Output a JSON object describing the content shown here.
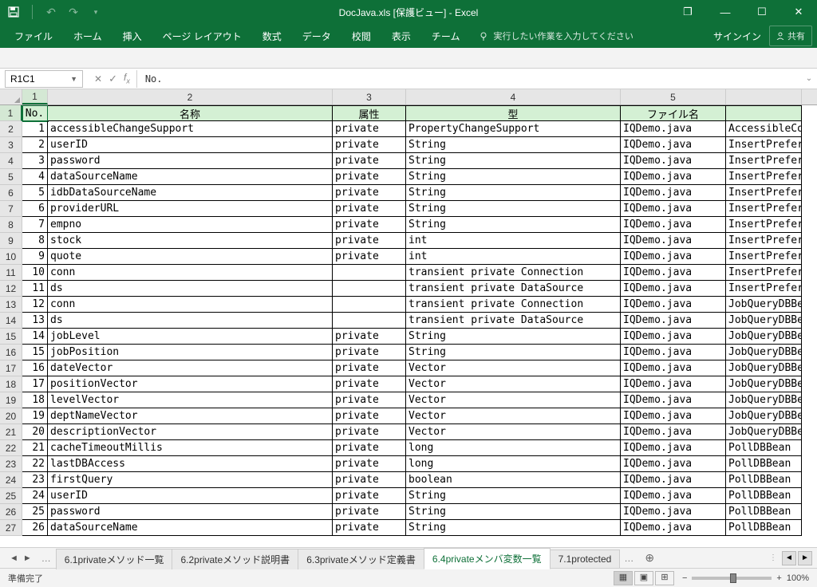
{
  "title": "DocJava.xls  [保護ビュー] - Excel",
  "qat": {
    "undo": "↶",
    "redo": "↷"
  },
  "winbtns": {
    "restore": "❐",
    "min": "—",
    "max": "☐",
    "close": "✕"
  },
  "tabs": [
    "ファイル",
    "ホーム",
    "挿入",
    "ページ レイアウト",
    "数式",
    "データ",
    "校閲",
    "表示",
    "チーム"
  ],
  "tellme": "実行したい作業を入力してください",
  "signin": "サインイン",
  "share": "共有",
  "namebox": "R1C1",
  "fx_value": "No.",
  "col_headers": [
    "1",
    "2",
    "3",
    "4",
    "5"
  ],
  "table": {
    "headers": [
      "No.",
      "名称",
      "属性",
      "型",
      "ファイル名",
      ""
    ],
    "rows": [
      [
        "1",
        "accessibleChangeSupport",
        "private",
        "PropertyChangeSupport",
        "IQDemo.java",
        "AccessibleCo"
      ],
      [
        "2",
        "userID",
        "private",
        "String",
        "IQDemo.java",
        "InsertPrefer"
      ],
      [
        "3",
        "password",
        "private",
        "String",
        "IQDemo.java",
        "InsertPrefer"
      ],
      [
        "4",
        "dataSourceName",
        "private",
        "String",
        "IQDemo.java",
        "InsertPrefer"
      ],
      [
        "5",
        "idbDataSourceName",
        "private",
        "String",
        "IQDemo.java",
        "InsertPrefer"
      ],
      [
        "6",
        "providerURL",
        "private",
        "String",
        "IQDemo.java",
        "InsertPrefer"
      ],
      [
        "7",
        "empno",
        "private",
        "String",
        "IQDemo.java",
        "InsertPrefer"
      ],
      [
        "8",
        "stock",
        "private",
        "int",
        "IQDemo.java",
        "InsertPrefer"
      ],
      [
        "9",
        "quote",
        "private",
        "int",
        "IQDemo.java",
        "InsertPrefer"
      ],
      [
        "10",
        "conn",
        "",
        "transient private Connection",
        "IQDemo.java",
        "InsertPrefer"
      ],
      [
        "11",
        "ds",
        "",
        "transient private DataSource",
        "IQDemo.java",
        "InsertPrefer"
      ],
      [
        "12",
        "conn",
        "",
        "transient private Connection",
        "IQDemo.java",
        "JobQueryDBBe"
      ],
      [
        "13",
        "ds",
        "",
        "transient private DataSource",
        "IQDemo.java",
        "JobQueryDBBe"
      ],
      [
        "14",
        "jobLevel",
        "private",
        "String",
        "IQDemo.java",
        "JobQueryDBBe"
      ],
      [
        "15",
        "jobPosition",
        "private",
        "String",
        "IQDemo.java",
        "JobQueryDBBe"
      ],
      [
        "16",
        "dateVector",
        "private",
        "Vector",
        "IQDemo.java",
        "JobQueryDBBe"
      ],
      [
        "17",
        "positionVector",
        "private",
        "Vector",
        "IQDemo.java",
        "JobQueryDBBe"
      ],
      [
        "18",
        "levelVector",
        "private",
        "Vector",
        "IQDemo.java",
        "JobQueryDBBe"
      ],
      [
        "19",
        "deptNameVector",
        "private",
        "Vector",
        "IQDemo.java",
        "JobQueryDBBe"
      ],
      [
        "20",
        "descriptionVector",
        "private",
        "Vector",
        "IQDemo.java",
        "JobQueryDBBe"
      ],
      [
        "21",
        "cacheTimeoutMillis",
        "private",
        "long",
        "IQDemo.java",
        "PollDBBean"
      ],
      [
        "22",
        "lastDBAccess",
        "private",
        "long",
        "IQDemo.java",
        "PollDBBean"
      ],
      [
        "23",
        "firstQuery",
        "private",
        "boolean",
        "IQDemo.java",
        "PollDBBean"
      ],
      [
        "24",
        "userID",
        "private",
        "String",
        "IQDemo.java",
        "PollDBBean"
      ],
      [
        "25",
        "password",
        "private",
        "String",
        "IQDemo.java",
        "PollDBBean"
      ],
      [
        "26",
        "dataSourceName",
        "private",
        "String",
        "IQDemo.java",
        "PollDBBean"
      ]
    ]
  },
  "sheets": {
    "dots": "…",
    "items": [
      "6.1privateメソッド一覧",
      "6.2privateメソッド説明書",
      "6.3privateメソッド定義書",
      "6.4privateメンバ変数一覧",
      "7.1protected"
    ],
    "active_index": 3,
    "more": "…"
  },
  "statusbar": {
    "ready": "準備完了",
    "zoom": "100%",
    "minus": "−",
    "plus": "+"
  }
}
